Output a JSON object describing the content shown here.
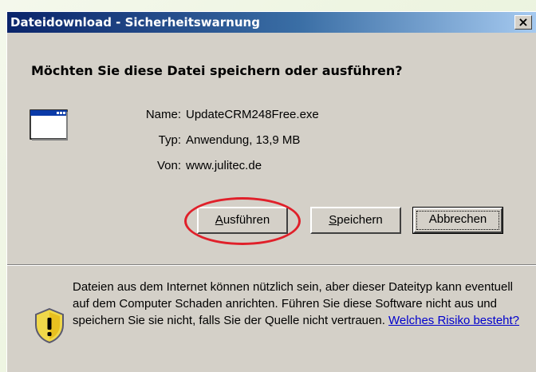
{
  "window": {
    "title": "Dateidownload - Sicherheitswarnung",
    "close_label": "×"
  },
  "dialog": {
    "question": "Möchten Sie diese Datei speichern oder ausführen?",
    "file_info": {
      "name_label": "Name:",
      "name_value": "UpdateCRM248Free.exe",
      "type_label": "Typ:",
      "type_value": "Anwendung, 13,9 MB",
      "from_label": "Von:",
      "from_value": "www.julitec.de"
    },
    "buttons": {
      "run_accel": "A",
      "run_rest": "usführen",
      "save_accel": "S",
      "save_rest": "peichern",
      "cancel": "Abbrechen"
    },
    "warning": {
      "text": "Dateien aus dem Internet können nützlich sein, aber dieser Dateityp kann eventuell auf dem Computer Schaden anrichten. Führen Sie diese Software nicht aus und speichern Sie sie nicht, falls Sie der Quelle nicht vertrauen.",
      "link": "Welches Risiko besteht?"
    }
  },
  "colors": {
    "titlebar_start": "#0a246a",
    "titlebar_end": "#a6caf0",
    "dialog_bg": "#d4d0c8",
    "annotation_circle": "#e0202a",
    "link": "#0000cc"
  },
  "icons": [
    "application-window-icon",
    "warning-shield-icon",
    "close-icon"
  ]
}
